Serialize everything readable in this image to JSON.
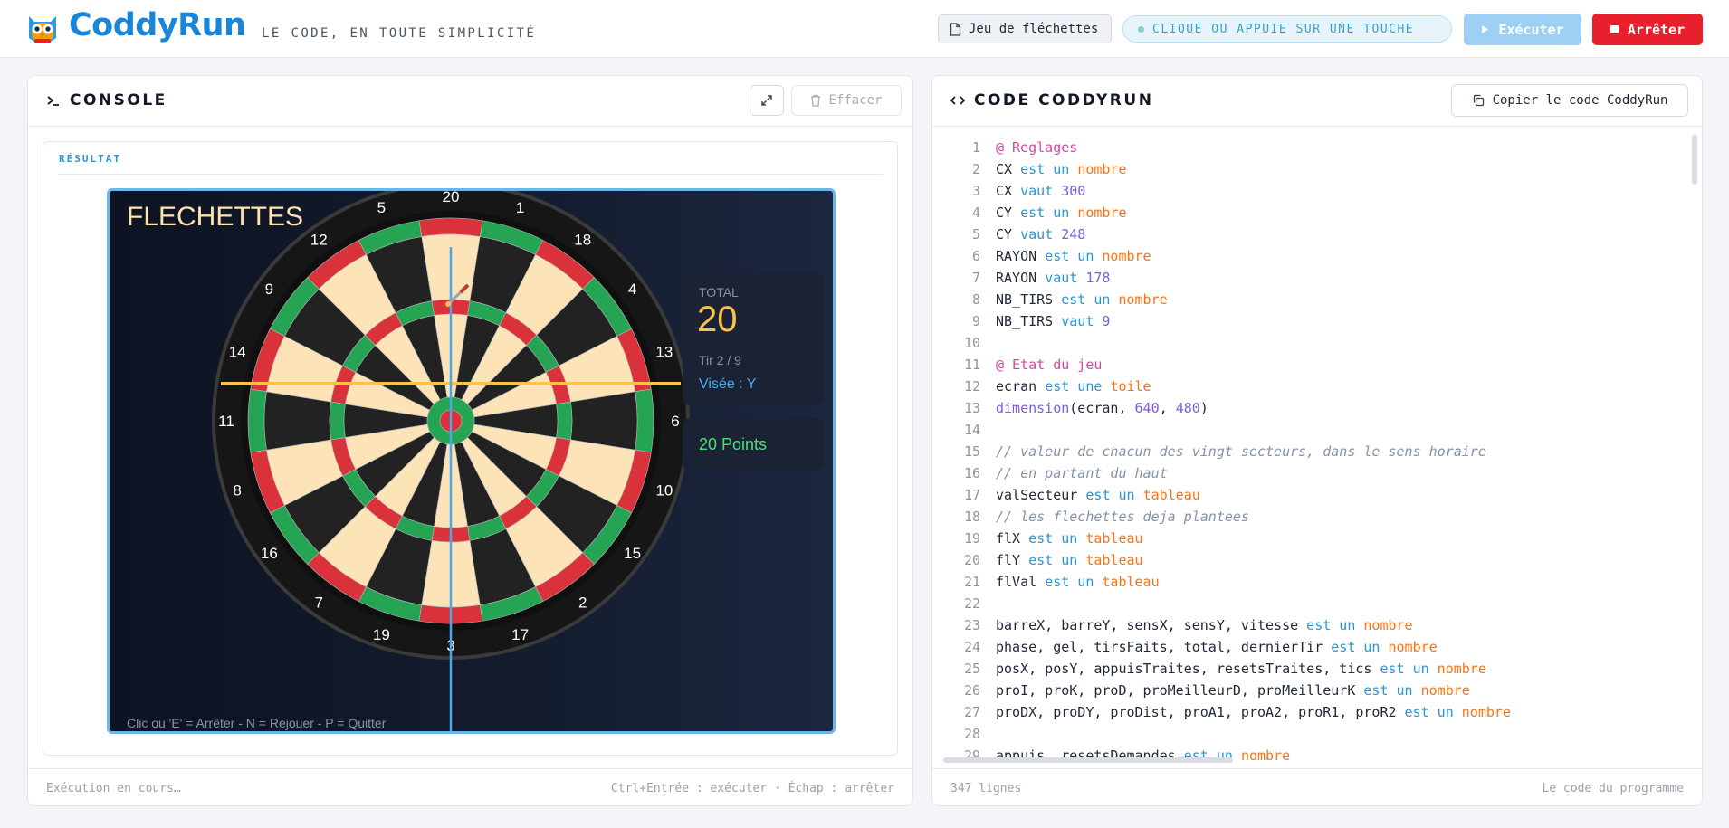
{
  "header": {
    "brand": "CoddyRun",
    "tagline": "LE CODE, EN TOUTE SIMPLICITÉ",
    "file_label": "Jeu de fléchettes",
    "hint": "CLIQUE OU APPUIE SUR UNE TOUCHE",
    "run_label": "Exécuter",
    "stop_label": "Arrêter"
  },
  "console": {
    "title": "CONSOLE",
    "clear_label": "Effacer",
    "result_label": "RÉSULTAT",
    "status": "Exécution en cours…",
    "shortcuts": "Ctrl+Entrée : exécuter · Échap : arrêter"
  },
  "game": {
    "title": "FLECHETTES",
    "help": "Clic ou 'E' = Arrêter - N = Rejouer - P = Quitter",
    "score_label": "TOTAL",
    "score_value": "20",
    "turn": "Tir 2 / 9",
    "aim": "Visée : Y",
    "last_points": "20 Points",
    "sectors": [
      "20",
      "1",
      "18",
      "4",
      "13",
      "6",
      "10",
      "15",
      "2",
      "17",
      "3",
      "19",
      "7",
      "16",
      "8",
      "11",
      "14",
      "9",
      "12",
      "5"
    ],
    "colors": {
      "background": "#0d1322",
      "cream": "#fde3b8",
      "dark": "#222222",
      "red": "#d9323b",
      "green": "#25a553",
      "aim_horizontal": "#fcc24a",
      "aim_vertical": "#49a8ea",
      "bull": "#d9323b"
    }
  },
  "code": {
    "title": "CODE CODDYRUN",
    "copy_label": "Copier le code CoddyRun",
    "line_count": "347 lignes",
    "footer_note": "Le code du programme",
    "lines": [
      [
        [
          "dir",
          "@ Reglages"
        ]
      ],
      [
        [
          "id",
          "CX "
        ],
        [
          "kw",
          "est un "
        ],
        [
          "ty",
          "nombre"
        ]
      ],
      [
        [
          "id",
          "CX "
        ],
        [
          "kw",
          "vaut "
        ],
        [
          "num",
          "300"
        ]
      ],
      [
        [
          "id",
          "CY "
        ],
        [
          "kw",
          "est un "
        ],
        [
          "ty",
          "nombre"
        ]
      ],
      [
        [
          "id",
          "CY "
        ],
        [
          "kw",
          "vaut "
        ],
        [
          "num",
          "248"
        ]
      ],
      [
        [
          "id",
          "RAYON "
        ],
        [
          "kw",
          "est un "
        ],
        [
          "ty",
          "nombre"
        ]
      ],
      [
        [
          "id",
          "RAYON "
        ],
        [
          "kw",
          "vaut "
        ],
        [
          "num",
          "178"
        ]
      ],
      [
        [
          "id",
          "NB_TIRS "
        ],
        [
          "kw",
          "est un "
        ],
        [
          "ty",
          "nombre"
        ]
      ],
      [
        [
          "id",
          "NB_TIRS "
        ],
        [
          "kw",
          "vaut "
        ],
        [
          "num",
          "9"
        ]
      ],
      [],
      [
        [
          "dir",
          "@ Etat du jeu"
        ]
      ],
      [
        [
          "id",
          "ecran "
        ],
        [
          "kw",
          "est une "
        ],
        [
          "ty",
          "toile"
        ]
      ],
      [
        [
          "fn",
          "dimension"
        ],
        [
          "id",
          "(ecran, "
        ],
        [
          "num",
          "640"
        ],
        [
          "id",
          ", "
        ],
        [
          "num",
          "480"
        ],
        [
          "id",
          ")"
        ]
      ],
      [],
      [
        [
          "cm",
          "// valeur de chacun des vingt secteurs, dans le sens horaire"
        ]
      ],
      [
        [
          "cm",
          "// en partant du haut"
        ]
      ],
      [
        [
          "id",
          "valSecteur "
        ],
        [
          "kw",
          "est un "
        ],
        [
          "ty",
          "tableau"
        ]
      ],
      [
        [
          "cm",
          "// les flechettes deja plantees"
        ]
      ],
      [
        [
          "id",
          "flX "
        ],
        [
          "kw",
          "est un "
        ],
        [
          "ty",
          "tableau"
        ]
      ],
      [
        [
          "id",
          "flY "
        ],
        [
          "kw",
          "est un "
        ],
        [
          "ty",
          "tableau"
        ]
      ],
      [
        [
          "id",
          "flVal "
        ],
        [
          "kw",
          "est un "
        ],
        [
          "ty",
          "tableau"
        ]
      ],
      [],
      [
        [
          "id",
          "barreX, barreY, sensX, sensY, vitesse "
        ],
        [
          "kw",
          "est un "
        ],
        [
          "ty",
          "nombre"
        ]
      ],
      [
        [
          "id",
          "phase, gel, tirsFaits, total, dernierTir "
        ],
        [
          "kw",
          "est un "
        ],
        [
          "ty",
          "nombre"
        ]
      ],
      [
        [
          "id",
          "posX, posY, appuisTraites, resetsTraites, tics "
        ],
        [
          "kw",
          "est un "
        ],
        [
          "ty",
          "nombre"
        ]
      ],
      [
        [
          "id",
          "proI, proK, proD, proMeilleurD, proMeilleurK "
        ],
        [
          "kw",
          "est un "
        ],
        [
          "ty",
          "nombre"
        ]
      ],
      [
        [
          "id",
          "proDX, proDY, proDist, proA1, proA2, proR1, proR2 "
        ],
        [
          "kw",
          "est un "
        ],
        [
          "ty",
          "nombre"
        ]
      ],
      [],
      [
        [
          "id",
          "appuis, resetsDemandes "
        ],
        [
          "kw",
          "est un "
        ],
        [
          "ty",
          "nombre"
        ]
      ]
    ]
  }
}
